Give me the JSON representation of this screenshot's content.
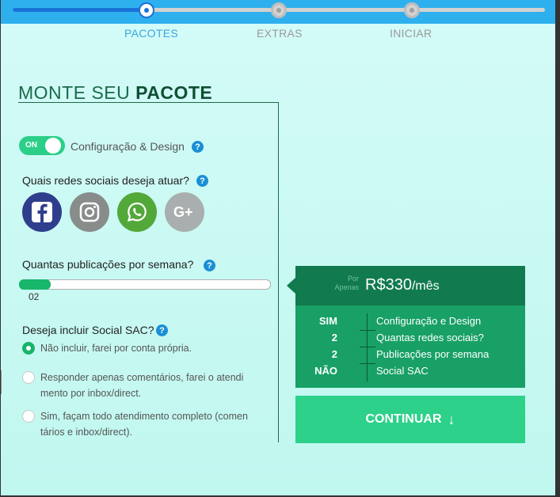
{
  "stepper": {
    "steps": [
      {
        "label": "PACOTES",
        "state": "active"
      },
      {
        "label": "EXTRAS",
        "state": "inactive"
      },
      {
        "label": "INICIAR",
        "state": "inactive"
      }
    ],
    "progress": 0.25
  },
  "heading": {
    "prefix": "MONTE SEU",
    "emphasis": "PACOTE"
  },
  "design_toggle": {
    "state_label": "ON",
    "label": "Configuração & Design",
    "on": true
  },
  "help_glyph": "?",
  "social": {
    "question": "Quais redes sociais deseja atuar?",
    "networks": [
      {
        "name": "facebook-icon",
        "color": "#2f3e8c"
      },
      {
        "name": "instagram-icon",
        "color": "#888d8c"
      },
      {
        "name": "whatsapp-icon",
        "color": "#53a83a"
      },
      {
        "name": "google-plus-icon",
        "color": "#a9aeae"
      }
    ]
  },
  "publications": {
    "question": "Quantas publicações por semana?",
    "value": "02",
    "fill_fraction": 0.12
  },
  "sac": {
    "question": "Deseja incluir Social SAC?",
    "options": [
      {
        "text": "Não incluir, farei por conta própria.",
        "checked": true
      },
      {
        "text": "Responder apenas comentários, farei o atendi\nmento por inbox/direct.",
        "checked": false
      },
      {
        "text": "Sim, façam todo atendimento completo (comen\ntários e inbox/direct).",
        "checked": false
      }
    ]
  },
  "price": {
    "prefix_line1": "Por",
    "prefix_line2": "Apenas",
    "amount": "R$330",
    "period": "/mês"
  },
  "summary": [
    {
      "value": "SIM",
      "label": "Configuração e Design"
    },
    {
      "value": "2",
      "label": "Quantas redes sociais?"
    },
    {
      "value": "2",
      "label": "Publicações por semana"
    },
    {
      "value": "NÃO",
      "label": "Social SAC"
    }
  ],
  "continue_button": {
    "label": "CONTINUAR",
    "icon": "arrow-down-icon"
  },
  "colors": {
    "header": "#2fb0ee",
    "accent_green": "#2dd18a",
    "dark_green": "#117a4e",
    "summary_green": "#18a066",
    "step_active": "#1a72d6"
  }
}
